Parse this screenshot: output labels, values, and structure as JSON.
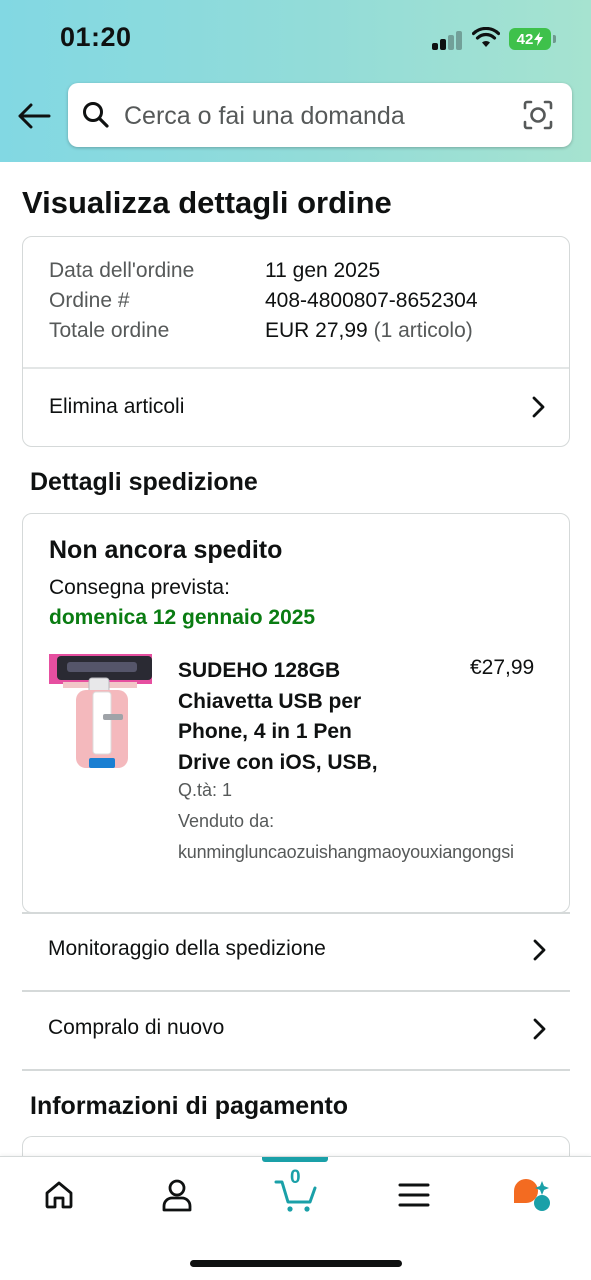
{
  "status_bar": {
    "time": "01:20",
    "battery": "42"
  },
  "header": {
    "search_placeholder": "Cerca o fai una domanda"
  },
  "page_title": "Visualizza dettagli ordine",
  "order_summary": {
    "date_label": "Data dell'ordine",
    "date_value": "11 gen 2025",
    "number_label": "Ordine #",
    "number_value": "408-4800807-8652304",
    "total_label": "Totale ordine",
    "total_value": "EUR 27,99",
    "total_items": "(1 articolo)",
    "delete_items_label": "Elimina articoli"
  },
  "shipment": {
    "section_title": "Dettagli spedizione",
    "status": "Non ancora spedito",
    "delivery_label": "Consegna prevista:",
    "delivery_date": "domenica 12 gennaio 2025",
    "product": {
      "title_lines": [
        "SUDEHO 128GB",
        "Chiavetta USB per",
        "Phone, 4 in 1 Pen",
        "Drive con iOS, USB,"
      ],
      "price": "€27,99",
      "qty": "Q.tà: 1",
      "sold_by_label": "Venduto da:",
      "sold_by_value": "kunminglun­caozuishangmaoyouxiangongsi"
    },
    "colors": {
      "delivery_date": "#0a7c12"
    }
  },
  "actions": {
    "track_label": "Monitoraggio della spedizione",
    "buy_again_label": "Compralo di nuovo"
  },
  "payment": {
    "section_title": "Informazioni di pagamento"
  },
  "bottom_nav": {
    "items": [
      "home-icon",
      "account-icon",
      "cart-icon",
      "menu-icon",
      "rufus-icon"
    ],
    "cart_count": "0",
    "accent_color": "#1aa0a8"
  }
}
